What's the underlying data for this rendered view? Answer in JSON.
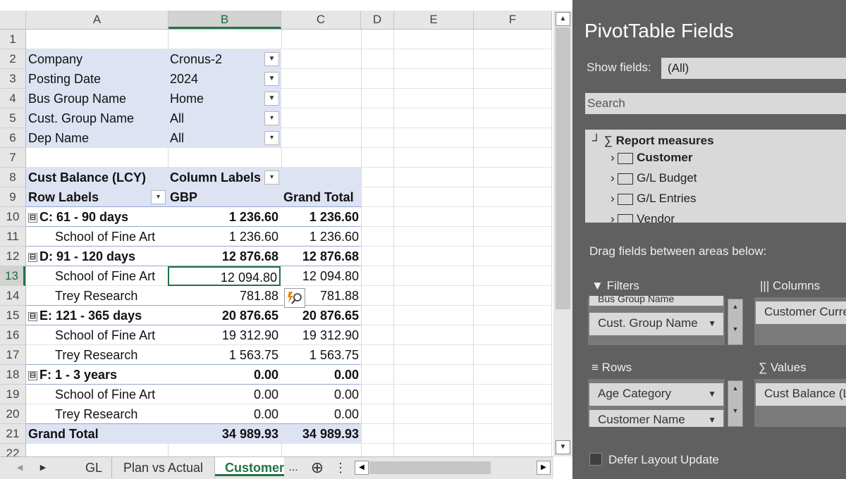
{
  "columns": [
    "A",
    "B",
    "C",
    "D",
    "E",
    "F"
  ],
  "selected_column": "B",
  "rows": [
    "1",
    "2",
    "3",
    "4",
    "5",
    "6",
    "7",
    "8",
    "9",
    "10",
    "11",
    "12",
    "13",
    "14",
    "15",
    "16",
    "17",
    "18",
    "19",
    "20",
    "21",
    "22"
  ],
  "selected_row": "13",
  "filters": [
    {
      "label": "Company",
      "value": "Cronus-2",
      "icon": "funnel-dropdown-icon"
    },
    {
      "label": "Posting Date",
      "value": "2024",
      "icon": "funnel-dropdown-icon"
    },
    {
      "label": "Bus Group Name",
      "value": "Home",
      "icon": "funnel-dropdown-icon"
    },
    {
      "label": "Cust. Group Name",
      "value": "All",
      "icon": "chevron-down-icon"
    },
    {
      "label": "Dep Name",
      "value": "All",
      "icon": "chevron-down-icon"
    }
  ],
  "pivot": {
    "value_header": "Cust Balance (LCY)",
    "column_labels": "Column Labels",
    "row_labels": "Row Labels",
    "currency": "GBP",
    "grand_total_header": "Grand Total",
    "collapse_symbol": "⊟",
    "rows": [
      {
        "label": "C: 61 - 90 days",
        "gbp": "1 236.60",
        "total": "1 236.60",
        "group": true
      },
      {
        "label": "School of Fine Art",
        "gbp": "1 236.60",
        "total": "1 236.60",
        "group": false
      },
      {
        "label": "D: 91 - 120 days",
        "gbp": "12 876.68",
        "total": "12 876.68",
        "group": true
      },
      {
        "label": "School of Fine Art",
        "gbp": "12 094.80",
        "total": "12 094.80",
        "group": false
      },
      {
        "label": "Trey Research",
        "gbp": "781.88",
        "total": "781.88",
        "group": false
      },
      {
        "label": "E: 121 - 365 days",
        "gbp": "20 876.65",
        "total": "20 876.65",
        "group": true
      },
      {
        "label": "School of Fine Art",
        "gbp": "19 312.90",
        "total": "19 312.90",
        "group": false
      },
      {
        "label": "Trey Research",
        "gbp": "1 563.75",
        "total": "1 563.75",
        "group": false
      },
      {
        "label": "F: 1 - 3 years",
        "gbp": "0.00",
        "total": "0.00",
        "group": true
      },
      {
        "label": "School of Fine Art",
        "gbp": "0.00",
        "total": "0.00",
        "group": false
      },
      {
        "label": "Trey Research",
        "gbp": "0.00",
        "total": "0.00",
        "group": false
      }
    ],
    "grand_total": {
      "label": "Grand Total",
      "gbp": "34 989.93",
      "total": "34 989.93"
    }
  },
  "sheet_tabs": {
    "nav_prev": "◀",
    "nav_next": "▶",
    "tabs": [
      "GL",
      "Plan vs Actual",
      "Customer"
    ],
    "active": "Customer",
    "more": "...",
    "add": "⊕",
    "menu": "⋮"
  },
  "pane": {
    "title": "PivotTable Fields",
    "show_fields_label": "Show fields:",
    "show_fields_value": "(All)",
    "search_placeholder": "Search",
    "tree": {
      "root": "Report measures",
      "root_icon": "sigma-icon",
      "items": [
        "Customer",
        "G/L Budget",
        "G/L Entries",
        "Vendor"
      ]
    },
    "drag_hint": "Drag fields between areas below:",
    "areas": {
      "filters": {
        "title": "Filters",
        "icon": "funnel-icon",
        "items": [
          "Bus Group Name",
          "Cust. Group Name"
        ]
      },
      "columns": {
        "title": "Columns",
        "icon": "columns-icon",
        "items": [
          "Customer Curre"
        ]
      },
      "rows": {
        "title": "Rows",
        "icon": "rows-icon",
        "items": [
          "Age Category",
          "Customer Name"
        ]
      },
      "values": {
        "title": "Values",
        "icon": "sigma-icon",
        "items": [
          "Cust Balance (LC"
        ]
      }
    },
    "defer_label": "Defer Layout Update",
    "defer_checked": false
  }
}
